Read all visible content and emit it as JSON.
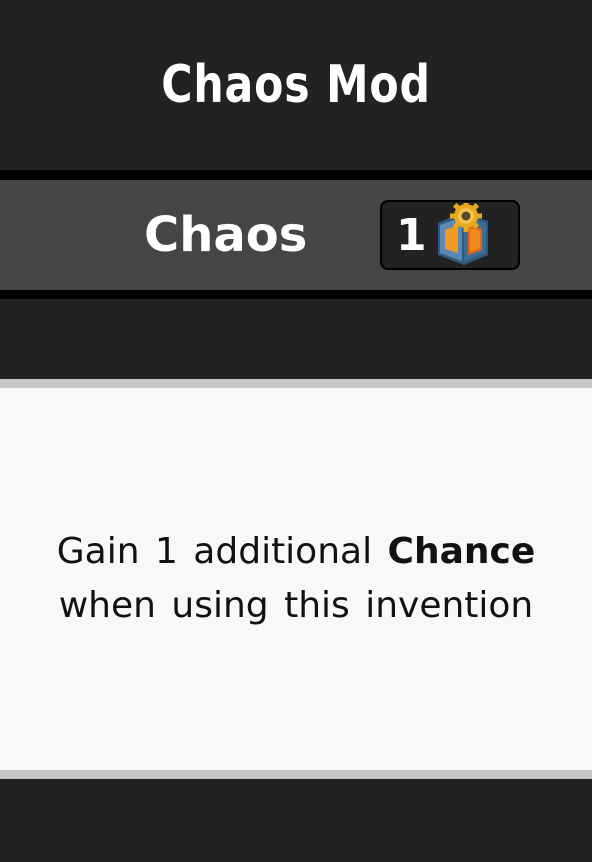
{
  "card": {
    "title": "Chaos Mod",
    "mod_name": "Chaos",
    "cost": {
      "amount": "1",
      "icon": "invention-crate-gear-icon"
    },
    "description": {
      "before": "Gain 1 additional ",
      "highlight": "Chance",
      "after": " when using this invention"
    }
  },
  "colors": {
    "background": "#222222",
    "band": "#454545",
    "panel": "#f8f8f8",
    "panel_border": "#c6c6c6",
    "crate_orange": "#f08a1c",
    "crate_blue": "#4f7fa8"
  }
}
